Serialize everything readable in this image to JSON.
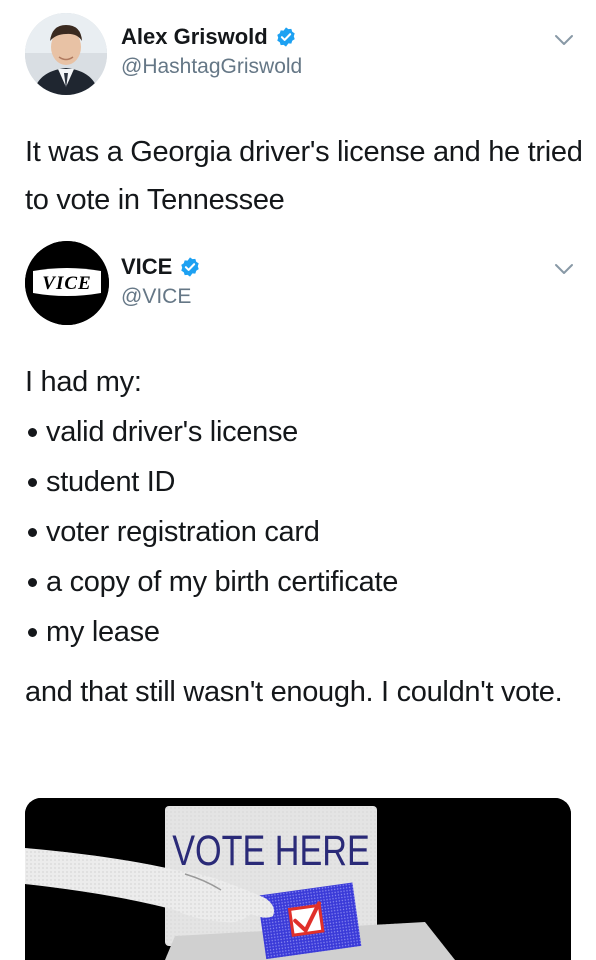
{
  "tweet": {
    "author_name": "Alex Griswold",
    "author_handle": "@HashtagGriswold",
    "text": "It was a Georgia driver's license and he tried to vote in Tennessee"
  },
  "quoted_tweet": {
    "author_name": "VICE",
    "author_handle": "@VICE",
    "logo_text": "VICE",
    "intro": "I had my:",
    "items": [
      "valid driver's license",
      "student ID",
      "voter registration card",
      "a copy of my birth certificate",
      "my lease"
    ],
    "outro": "and that still wasn't enough. I couldn't vote.",
    "media": {
      "sign_text": "VOTE HERE"
    }
  },
  "colors": {
    "verified": "#1da1f2",
    "text": "#14171a",
    "secondary_text": "#657786",
    "ballot_blue": "#3a3ad8",
    "check_red": "#e0302a"
  },
  "icons": [
    "verified-badge-icon",
    "chevron-down-icon",
    "check-mark-icon"
  ]
}
